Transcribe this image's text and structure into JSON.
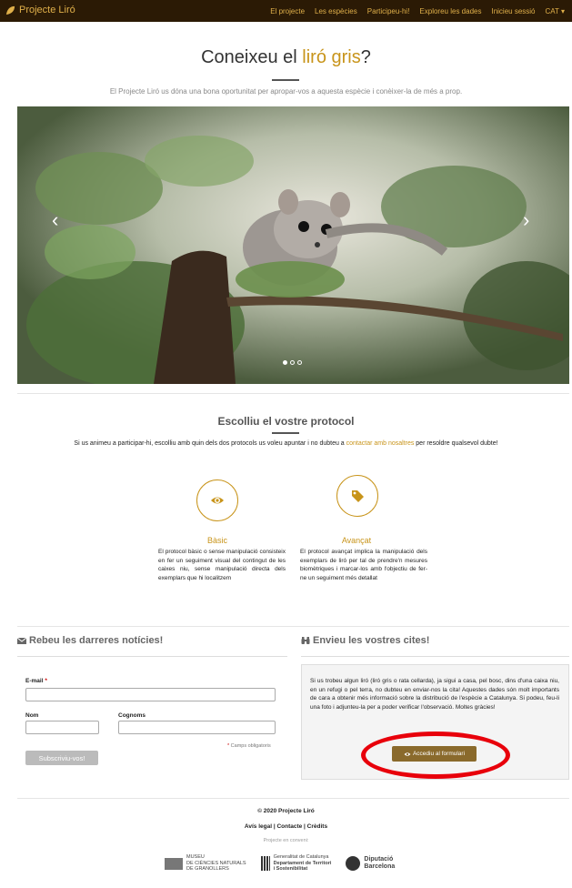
{
  "nav": {
    "brand": "Projecte Liró",
    "links": [
      "El projecte",
      "Les espècies",
      "Participeu-hi!",
      "Exploreu les dades",
      "Inicieu sessió",
      "CAT ▾"
    ]
  },
  "hero": {
    "title_start": "Coneixeu el",
    "title_accent": "liró gris",
    "title_end": "?",
    "subtitle": "El Projecte Liró us dóna una bona oportunitat per apropar-vos a aquesta espècie i conèixer-la de més a prop."
  },
  "carousel": {
    "prev": "‹",
    "next": "›",
    "slides": 3,
    "active": 0
  },
  "protocol": {
    "title": "Escolliu el vostre protocol",
    "intro_start": "Si us animeu a participar-hi, escolliu amb quin dels dos protocols us voleu apuntar i no dubteu a ",
    "intro_link": "contactar amb nosaltres",
    "intro_end": " per resoldre qualsevol dubte!",
    "basic": {
      "label": "Bàsic",
      "desc": "El protocol bàsic o sense manipulació consisteix en fer un seguiment visual del contingut de les caixes niu, sense manipulació directa dels exemplars que hi localitzem"
    },
    "advanced": {
      "label": "Avançat",
      "desc": "El protocol avançat implica la manipulació dels exemplars de liró per tal de prendre'n mesures biomètriques i marcar-los amb l'objectiu de fer-ne un seguiment més detallat"
    }
  },
  "newsletter": {
    "heading": "Rebeu les darreres notícies!",
    "email_label": "E-mail",
    "required_mark": "*",
    "name_label": "Nom",
    "surname_label": "Cognoms",
    "required_note": "Camps obligatoris",
    "subscribe": "Subscriviu-vos!"
  },
  "cites": {
    "heading": "Envieu les vostres cites!",
    "text": "Si us trobeu algun liró (liró gris o rata cellarda), ja sigui a casa, pel bosc, dins d'una caixa niu, en un refugi o pel terra, no dubteu en enviar-nos la cita! Aquestes dades són molt importants de cara a obtenir més informació sobre la distribució de l'espècie a Catalunya. Si podeu, feu-li una foto i adjunteu-la per a poder verificar l'observació. Moltes gràcies!",
    "button": "Accediu al formulari"
  },
  "footer": {
    "copyright": "© 2020 Projecte Liró",
    "links": "Avís legal | Contacte | Crèdits",
    "partners_label": "Projecte en conveni:",
    "logo1": [
      "MUSEU",
      "DE CIÈNCIES NATURALS",
      "DE GRANOLLERS"
    ],
    "logo2": [
      "Generalitat de Catalunya",
      "Departament de Territori",
      "i Sostenibilitat"
    ],
    "logo3": [
      "Diputació",
      "Barcelona"
    ]
  },
  "colors": {
    "accent": "#c8941a",
    "nav_bg": "#2b1a05",
    "button": "#8a6a2c",
    "annotation": "#e8000b"
  }
}
